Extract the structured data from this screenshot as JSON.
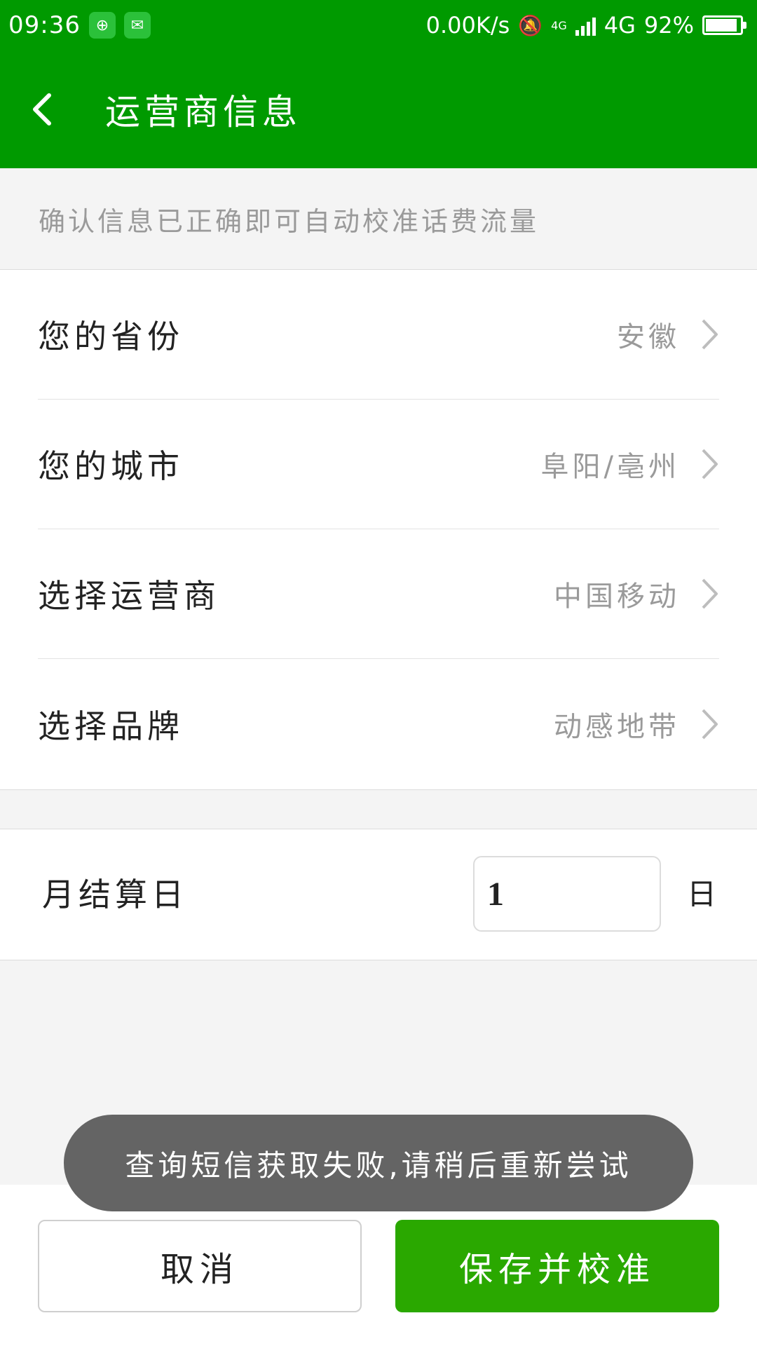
{
  "status_bar": {
    "time": "09:36",
    "net_speed": "0.00K/s",
    "network_small": "4G",
    "network": "4G",
    "battery": "92%",
    "battery_level": 0.92,
    "apps": [
      "add-app-icon",
      "wechat-icon"
    ]
  },
  "header": {
    "title": "运营商信息"
  },
  "hint": "确认信息已正确即可自动校准话费流量",
  "settings": {
    "items": [
      {
        "label": "您的省份",
        "value": "安徽"
      },
      {
        "label": "您的城市",
        "value": "阜阳/亳州"
      },
      {
        "label": "选择运营商",
        "value": "中国移动"
      },
      {
        "label": "选择品牌",
        "value": "动感地带"
      }
    ]
  },
  "billing": {
    "label": "月结算日",
    "day_value": "1",
    "unit": "日"
  },
  "toast": "查询短信获取失败,请稍后重新尝试",
  "buttons": {
    "cancel": "取消",
    "save": "保存并校准"
  },
  "colors": {
    "brand_green": "#009a00",
    "save_green": "#2aa800",
    "toast_gray": "#646464"
  }
}
